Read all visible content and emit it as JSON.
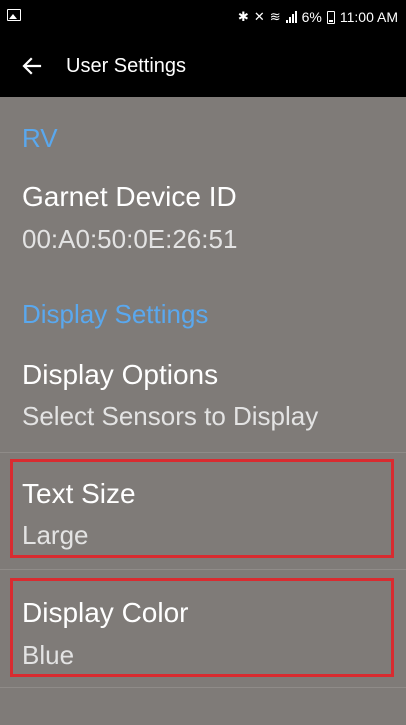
{
  "status_bar": {
    "battery_percent": "6%",
    "time": "11:00 AM",
    "icons": [
      "image-icon",
      "bluetooth-icon",
      "mute-icon",
      "wifi-icon",
      "signal-icon",
      "battery-icon"
    ]
  },
  "app_bar": {
    "back_icon": "arrow-left-icon",
    "title": "User Settings"
  },
  "sections": {
    "rv": {
      "header": "RV",
      "device": {
        "title": "Garnet Device ID",
        "summary": "00:A0:50:0E:26:51"
      }
    },
    "display": {
      "header": "Display Settings",
      "options": {
        "title": "Display Options",
        "summary": "Select Sensors to Display"
      },
      "text_size": {
        "title": "Text Size",
        "summary": "Large"
      },
      "color": {
        "title": "Display Color",
        "summary": "Blue"
      }
    }
  },
  "colors": {
    "background": "#7f7b78",
    "accent": "#5aa8ee",
    "highlight": "#d92b30"
  }
}
